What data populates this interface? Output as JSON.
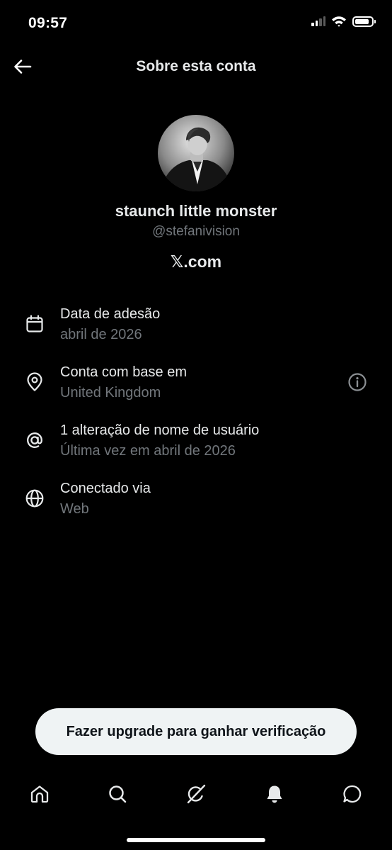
{
  "status_bar": {
    "time": "09:57",
    "battery_level": 0.85
  },
  "header": {
    "title": "Sobre esta conta"
  },
  "profile": {
    "display_name": "staunch little monster",
    "handle": "@stefanivision",
    "platform": "𝕏.com"
  },
  "info_rows": [
    {
      "icon": "calendar-icon",
      "title": "Data de adesão",
      "value": "abril de 2026"
    },
    {
      "icon": "location-pin-icon",
      "title": "Conta com base em",
      "value": "United Kingdom",
      "extra_icon": "info-icon"
    },
    {
      "icon": "at-sign-icon",
      "title": "1 alteração de nome de usuário",
      "value": "Última vez em abril de 2026"
    },
    {
      "icon": "globe-icon",
      "title": "Conectado via",
      "value": "Web"
    }
  ],
  "upgrade_button": {
    "label": "Fazer upgrade para ganhar verificação"
  },
  "tabbar": [
    "home-icon",
    "search-icon",
    "grok-icon",
    "notifications-icon",
    "messages-icon"
  ],
  "colors": {
    "background": "#000000",
    "primary_text": "#e7e9ea",
    "secondary_text": "#71767b",
    "button_bg": "#eff3f4"
  }
}
